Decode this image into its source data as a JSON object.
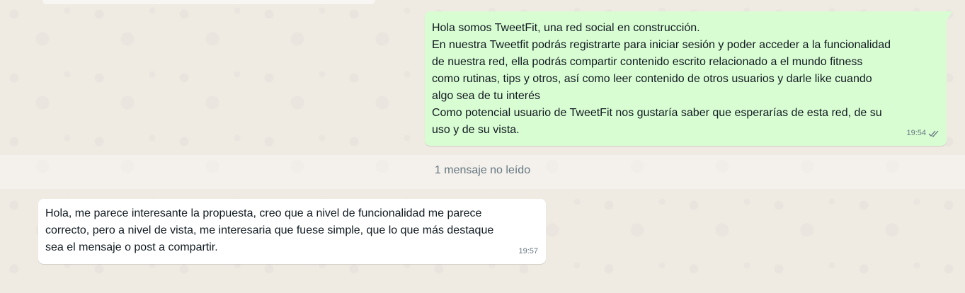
{
  "conversation": {
    "unread_divider": "1 mensaje no leído",
    "messages": [
      {
        "direction": "outgoing",
        "lines": [
          "Hola somos TweetFit, una red social en construcción.",
          "En nuestra Tweetfit podrás registrarte para iniciar sesión y poder acceder a la funcionalidad",
          "de nuestra red, ella podrás compartir contenido escrito relacionado a el mundo fitness",
          "como rutinas, tips y otros, así como leer contenido de otros usuarios y darle like cuando",
          "algo sea de tu interés",
          "Como potencial usuario de TweetFit nos gustaría saber que esperarías de esta red, de su",
          "uso y de su vista."
        ],
        "time": "19:54",
        "status_icon": "double-check-icon"
      },
      {
        "direction": "incoming",
        "lines": [
          "Hola, me parece interesante la propuesta, creo que a nivel de funcionalidad me parece",
          "correcto, pero a nivel de vista, me interesaria que fuese simple, que lo que más destaque",
          "sea el mensaje o post a compartir."
        ],
        "time": "19:57"
      }
    ]
  },
  "colors": {
    "background": "#efeae2",
    "outgoing_bubble": "#d9fdd3",
    "incoming_bubble": "#ffffff",
    "text": "#111b21",
    "meta_text": "#667781",
    "read_tick": "#667781"
  }
}
